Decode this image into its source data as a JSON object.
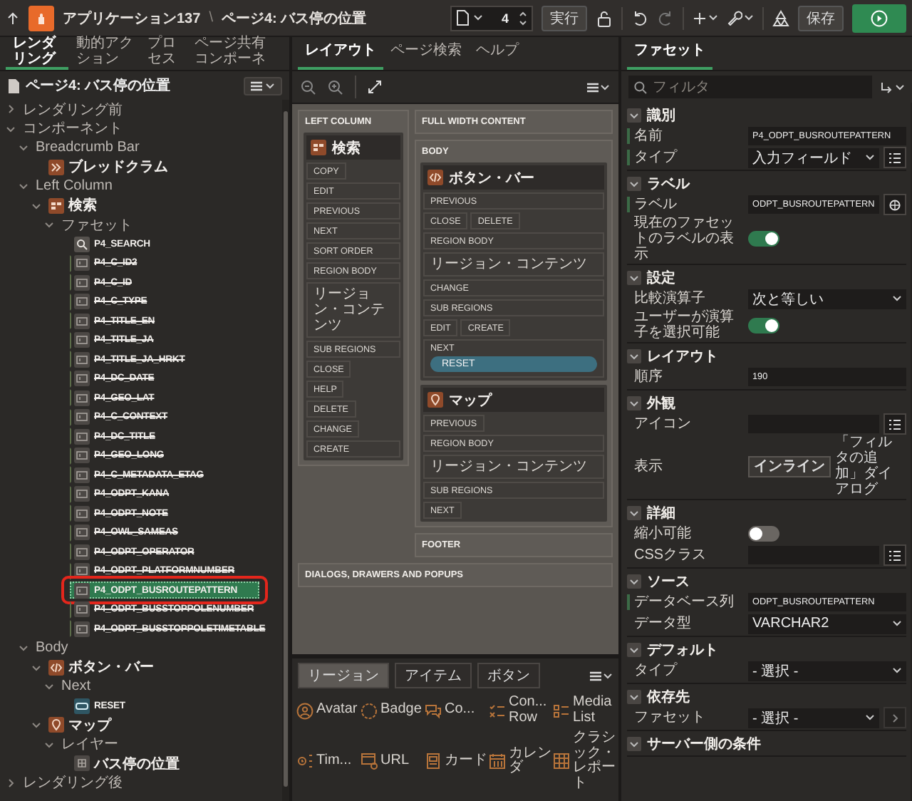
{
  "topbar": {
    "app_title": "アプリケーション137",
    "separator": "\\",
    "page_title": "ページ4: バス停の位置",
    "page_number": "4",
    "run_label": "実行",
    "save_label": "保存"
  },
  "left_panel": {
    "tabs": [
      {
        "label": "レンダリング",
        "selected": true
      },
      {
        "label": "動的アクション",
        "selected": false
      },
      {
        "label": "プロセス",
        "selected": false
      },
      {
        "label": "ページ共有コンポーネ",
        "selected": false
      }
    ],
    "page_title": "ページ4: バス停の位置",
    "tree": [
      {
        "label": "レンダリング前",
        "kind": "group",
        "expanded": false,
        "selected": false
      },
      {
        "label": "コンポーネント",
        "kind": "group",
        "expanded": true,
        "selected": false,
        "children": [
          {
            "label": "Breadcrumb Bar",
            "kind": "group",
            "expanded": true,
            "selected": false,
            "children": [
              {
                "label": "ブレッドクラム",
                "kind": "breadcrumb",
                "selected": false
              }
            ]
          },
          {
            "label": "Left Column",
            "kind": "group",
            "expanded": true,
            "selected": false,
            "children": [
              {
                "label": "検索",
                "kind": "search-region",
                "expanded": true,
                "selected": false,
                "children": [
                  {
                    "label": "ファセット",
                    "kind": "group",
                    "expanded": true,
                    "selected": false,
                    "children": [
                      {
                        "label": "P4_SEARCH",
                        "kind": "search",
                        "selected": false,
                        "disabled": false
                      },
                      {
                        "label": "P4_C_ID2",
                        "kind": "facet",
                        "selected": false,
                        "disabled": true
                      },
                      {
                        "label": "P4_C_ID",
                        "kind": "facet",
                        "selected": false,
                        "disabled": true
                      },
                      {
                        "label": "P4_C_TYPE",
                        "kind": "facet",
                        "selected": false,
                        "disabled": true
                      },
                      {
                        "label": "P4_TITLE_EN",
                        "kind": "facet",
                        "selected": false,
                        "disabled": true
                      },
                      {
                        "label": "P4_TITLE_JA",
                        "kind": "facet",
                        "selected": false,
                        "disabled": true
                      },
                      {
                        "label": "P4_TITLE_JA_HRKT",
                        "kind": "facet",
                        "selected": false,
                        "disabled": true
                      },
                      {
                        "label": "P4_DC_DATE",
                        "kind": "facet",
                        "selected": false,
                        "disabled": true
                      },
                      {
                        "label": "P4_GEO_LAT",
                        "kind": "facet",
                        "selected": false,
                        "disabled": true
                      },
                      {
                        "label": "P4_C_CONTEXT",
                        "kind": "facet",
                        "selected": false,
                        "disabled": true
                      },
                      {
                        "label": "P4_DC_TITLE",
                        "kind": "facet",
                        "selected": false,
                        "disabled": true
                      },
                      {
                        "label": "P4_GEO_LONG",
                        "kind": "facet",
                        "selected": false,
                        "disabled": true
                      },
                      {
                        "label": "P4_C_METADATA_ETAG",
                        "kind": "facet",
                        "selected": false,
                        "disabled": true
                      },
                      {
                        "label": "P4_ODPT_KANA",
                        "kind": "facet",
                        "selected": false,
                        "disabled": true
                      },
                      {
                        "label": "P4_ODPT_NOTE",
                        "kind": "facet",
                        "selected": false,
                        "disabled": true
                      },
                      {
                        "label": "P4_OWL_SAMEAS",
                        "kind": "facet",
                        "selected": false,
                        "disabled": true
                      },
                      {
                        "label": "P4_ODPT_OPERATOR",
                        "kind": "facet",
                        "selected": false,
                        "disabled": true
                      },
                      {
                        "label": "P4_ODPT_PLATFORMNUMBER",
                        "kind": "facet",
                        "selected": false,
                        "disabled": true
                      },
                      {
                        "label": "P4_ODPT_BUSROUTEPATTERN",
                        "kind": "facet",
                        "selected": true,
                        "disabled": false,
                        "highlighted": true
                      },
                      {
                        "label": "P4_ODPT_BUSSTOPPOLENUMBER",
                        "kind": "facet",
                        "selected": false,
                        "disabled": true
                      },
                      {
                        "label": "P4_ODPT_BUSSTOPPOLETIMETABLE",
                        "kind": "facet",
                        "selected": false,
                        "disabled": true
                      }
                    ]
                  }
                ]
              }
            ]
          },
          {
            "label": "Body",
            "kind": "group",
            "expanded": true,
            "selected": false,
            "children": [
              {
                "label": "ボタン・バー",
                "kind": "static-region",
                "expanded": true,
                "selected": false,
                "children": [
                  {
                    "label": "Next",
                    "kind": "group",
                    "expanded": true,
                    "selected": false,
                    "children": [
                      {
                        "label": "RESET",
                        "kind": "button",
                        "selected": false
                      }
                    ]
                  }
                ]
              },
              {
                "label": "マップ",
                "kind": "map",
                "expanded": true,
                "selected": false,
                "children": [
                  {
                    "label": "レイヤー",
                    "kind": "group",
                    "expanded": true,
                    "selected": false,
                    "children": [
                      {
                        "label": "バス停の位置",
                        "kind": "layer",
                        "selected": false
                      }
                    ]
                  }
                ]
              }
            ]
          }
        ]
      },
      {
        "label": "レンダリング後",
        "kind": "group",
        "expanded": false,
        "selected": false
      }
    ]
  },
  "layout_panel": {
    "tabs": [
      {
        "label": "レイアウト",
        "selected": true
      },
      {
        "label": "ページ検索",
        "selected": false
      },
      {
        "label": "ヘルプ",
        "selected": false
      }
    ],
    "canvas": {
      "left_column": {
        "title": "LEFT COLUMN",
        "regions": [
          {
            "kind": "search",
            "title": "検索",
            "rows": [
              [
                {
                  "label": "COPY",
                  "kind": "narrow"
                }
              ],
              [
                {
                  "label": "EDIT",
                  "kind": "wide"
                }
              ],
              [
                {
                  "label": "PREVIOUS",
                  "kind": "wide"
                }
              ],
              [
                {
                  "label": "NEXT",
                  "kind": "wide"
                }
              ],
              [
                {
                  "label": "SORT ORDER",
                  "kind": "wide"
                }
              ],
              [
                {
                  "label": "REGION BODY",
                  "kind": "wide"
                }
              ],
              [
                {
                  "label": "リージョン・コンテンツ",
                  "kind": "content"
                }
              ],
              [
                {
                  "label": "SUB REGIONS",
                  "kind": "wide"
                }
              ],
              [
                {
                  "label": "CLOSE",
                  "kind": "narrow"
                }
              ],
              [
                {
                  "label": "HELP",
                  "kind": "narrow"
                }
              ],
              [
                {
                  "label": "DELETE",
                  "kind": "narrow"
                }
              ],
              [
                {
                  "label": "CHANGE",
                  "kind": "narrow"
                }
              ],
              [
                {
                  "label": "CREATE",
                  "kind": "wide"
                }
              ]
            ]
          }
        ]
      },
      "full_width": {
        "title": "FULL WIDTH CONTENT"
      },
      "body": {
        "title": "BODY",
        "regions": [
          {
            "kind": "static",
            "title": "ボタン・バー",
            "rows": [
              [
                {
                  "label": "PREVIOUS",
                  "kind": "wide"
                }
              ],
              [
                {
                  "label": "CLOSE",
                  "kind": "narrow"
                },
                {
                  "label": "DELETE",
                  "kind": "narrow"
                }
              ],
              [
                {
                  "label": "REGION BODY",
                  "kind": "wide"
                }
              ],
              [
                {
                  "label": "リージョン・コンテンツ",
                  "kind": "content"
                }
              ],
              [
                {
                  "label": "CHANGE",
                  "kind": "wide"
                }
              ],
              [
                {
                  "label": "SUB REGIONS",
                  "kind": "wide"
                }
              ],
              [
                {
                  "label": "EDIT",
                  "kind": "narrow"
                },
                {
                  "label": "CREATE",
                  "kind": "narrow"
                }
              ],
              [
                {
                  "label": "NEXT",
                  "kind": "wide",
                  "buttons": [
                    {
                      "label": "RESET"
                    }
                  ]
                }
              ]
            ]
          },
          {
            "kind": "map",
            "title": "マップ",
            "rows": [
              [
                {
                  "label": "PREVIOUS",
                  "kind": "narrow"
                }
              ],
              [
                {
                  "label": "REGION BODY",
                  "kind": "wide"
                }
              ],
              [
                {
                  "label": "リージョン・コンテンツ",
                  "kind": "content"
                }
              ],
              [
                {
                  "label": "SUB REGIONS",
                  "kind": "wide"
                }
              ],
              [
                {
                  "label": "NEXT",
                  "kind": "narrow"
                }
              ]
            ]
          }
        ]
      },
      "footer": {
        "title": "FOOTER"
      },
      "dialogs": {
        "title": "DIALOGS, DRAWERS AND POPUPS"
      }
    },
    "gallery": {
      "tabs": [
        {
          "label": "リージョン",
          "selected": true
        },
        {
          "label": "アイテム",
          "selected": false
        },
        {
          "label": "ボタン",
          "selected": false
        }
      ],
      "items": [
        {
          "label": "Avatar",
          "kind": "avatar"
        },
        {
          "label": "Badge",
          "kind": "badge"
        },
        {
          "label": "Co...",
          "kind": "comments"
        },
        {
          "label": "Con... Row",
          "kind": "content-row"
        },
        {
          "label": "Media List",
          "kind": "media-list"
        },
        {
          "label": "Tim...",
          "kind": "timeline"
        },
        {
          "label": "URL",
          "kind": "url"
        },
        {
          "label": "カード",
          "kind": "cards"
        },
        {
          "label": "カレンダ",
          "kind": "calendar"
        },
        {
          "label": "クラシック・レポート",
          "kind": "report"
        }
      ]
    }
  },
  "property_panel": {
    "tabs": [
      {
        "label": "ファセット",
        "selected": true
      }
    ],
    "filter_placeholder": "フィルタ",
    "sections": [
      {
        "title": "識別",
        "fields": [
          {
            "label": "名前",
            "kind": "text",
            "value": "P4_ODPT_BUSROUTEPATTERN",
            "required": true
          },
          {
            "label": "タイプ",
            "kind": "select-picker",
            "value": "入力フィールド",
            "required": true
          }
        ]
      },
      {
        "title": "ラベル",
        "fields": [
          {
            "label": "ラベル",
            "kind": "text-translate",
            "value": "ODPT_BUSROUTEPATTERN",
            "required": true
          },
          {
            "label": "現在のファセットのラベルの表示",
            "kind": "switch",
            "on": true,
            "required": false
          }
        ]
      },
      {
        "title": "設定",
        "fields": [
          {
            "label": "比較演算子",
            "kind": "select",
            "value": "次と等しい",
            "required": false
          },
          {
            "label": "ユーザーが演算子を選択可能",
            "kind": "switch",
            "on": true,
            "required": false
          }
        ]
      },
      {
        "title": "レイアウト",
        "fields": [
          {
            "label": "順序",
            "kind": "text",
            "value": "190",
            "required": false
          }
        ]
      },
      {
        "title": "外観",
        "fields": [
          {
            "label": "アイコン",
            "kind": "text-picker",
            "required": false
          },
          {
            "label": "表示",
            "kind": "choice",
            "required": false,
            "options": [
              {
                "label": "インライン",
                "selected": true
              },
              {
                "label": "「フィルタの追加」ダイアログ",
                "selected": false
              }
            ]
          }
        ]
      },
      {
        "title": "詳細",
        "fields": [
          {
            "label": "縮小可能",
            "kind": "switch",
            "on": false,
            "required": false
          },
          {
            "label": "CSSクラス",
            "kind": "text-picker",
            "required": false
          }
        ]
      },
      {
        "title": "ソース",
        "fields": [
          {
            "label": "データベース列",
            "kind": "text",
            "value": "ODPT_BUSROUTEPATTERN",
            "required": true
          },
          {
            "label": "データ型",
            "kind": "select",
            "value": "VARCHAR2",
            "required": false
          }
        ]
      },
      {
        "title": "デフォルト",
        "fields": [
          {
            "label": "タイプ",
            "kind": "select",
            "value": "- 選択 -",
            "required": false
          }
        ]
      },
      {
        "title": "依存先",
        "fields": [
          {
            "label": "ファセット",
            "kind": "select-link",
            "value": "- 選択 -",
            "required": false
          }
        ]
      },
      {
        "title": "サーバー側の条件"
      }
    ]
  }
}
